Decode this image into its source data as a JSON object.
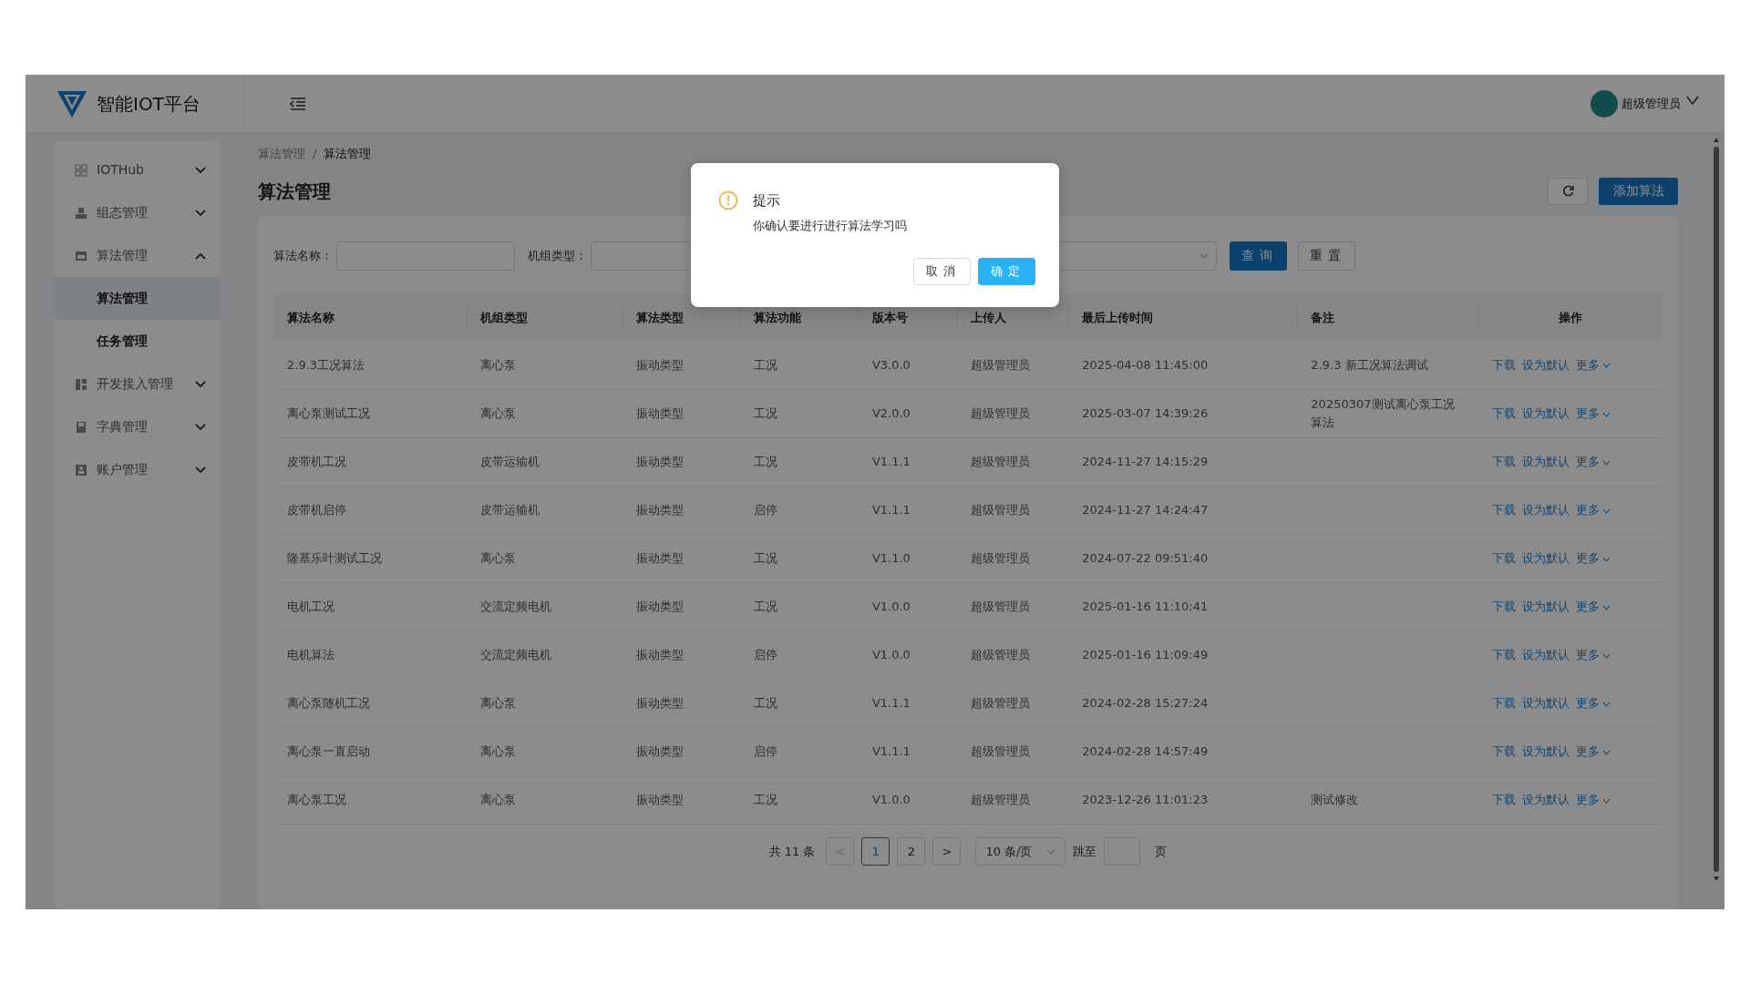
{
  "header": {
    "title": "智能IOT平台",
    "user": "超级管理员"
  },
  "sidebar": {
    "items": [
      {
        "label": "IOTHub",
        "expanded": false
      },
      {
        "label": "组态管理",
        "expanded": false
      },
      {
        "label": "算法管理",
        "expanded": true,
        "children": [
          {
            "label": "算法管理",
            "selected": true
          },
          {
            "label": "任务管理",
            "selected": false
          }
        ]
      },
      {
        "label": "开发接入管理",
        "expanded": false
      },
      {
        "label": "字典管理",
        "expanded": false
      },
      {
        "label": "账户管理",
        "expanded": false
      }
    ]
  },
  "breadcrumb": {
    "items": [
      "算法管理",
      "算法管理"
    ],
    "separator": "/"
  },
  "page_title": "算法管理",
  "add_button": "添加算法",
  "filters": [
    {
      "kind": "text",
      "label": "算法名称："
    },
    {
      "kind": "text",
      "label": "机组类型："
    },
    {
      "kind": "select"
    }
  ],
  "filter_buttons": [
    {
      "kind": "primary",
      "label": "查询"
    },
    {
      "kind": "default",
      "label": "重置"
    }
  ],
  "table": {
    "columns": [
      "算法名称",
      "机组类型",
      "算法类型",
      "算法功能",
      "版本号",
      "上传人",
      "最后上传时间",
      "备注",
      "操作"
    ],
    "rows": [
      {
        "cells": [
          "2.9.3工况算法",
          "离心泵",
          "振动类型",
          "工况",
          "V3.0.0",
          "超级管理员",
          "2025-04-08 11:45:00"
        ],
        "note": "2.9.3 新工况算法调试",
        "actions": [
          "下载",
          "设为默认",
          "更多"
        ]
      },
      {
        "cells": [
          "离心泵测试工况",
          "离心泵",
          "振动类型",
          "工况",
          "V2.0.0",
          "超级管理员",
          "2025-03-07 14:39:26"
        ],
        "note": "20250307测试离心泵工况算法",
        "actions": [
          "下载",
          "设为默认",
          "更多"
        ]
      },
      {
        "cells": [
          "皮带机工况",
          "皮带运输机",
          "振动类型",
          "工况",
          "V1.1.1",
          "超级管理员",
          "2024-11-27 14:15:29"
        ],
        "actions": [
          "下载",
          "设为默认",
          "更多"
        ]
      },
      {
        "cells": [
          "皮带机启停",
          "皮带运输机",
          "振动类型",
          "启停",
          "V1.1.1",
          "超级管理员",
          "2024-11-27 14:24:47"
        ],
        "actions": [
          "下载",
          "设为默认",
          "更多"
        ]
      },
      {
        "cells": [
          "隆基乐叶测试工况",
          "离心泵",
          "振动类型",
          "工况",
          "V1.1.0",
          "超级管理员",
          "2024-07-22 09:51:40"
        ],
        "actions": [
          "下载",
          "设为默认",
          "更多"
        ]
      },
      {
        "cells": [
          "电机工况",
          "交流定频电机",
          "振动类型",
          "工况",
          "V1.0.0",
          "超级管理员",
          "2025-01-16 11:10:41"
        ],
        "actions": [
          "下载",
          "设为默认",
          "更多"
        ]
      },
      {
        "cells": [
          "电机算法",
          "交流定频电机",
          "振动类型",
          "启停",
          "V1.0.0",
          "超级管理员",
          "2025-01-16 11:09:49"
        ],
        "actions": [
          "下载",
          "设为默认",
          "更多"
        ]
      },
      {
        "cells": [
          "离心泵随机工况",
          "离心泵",
          "振动类型",
          "工况",
          "V1.1.1",
          "超级管理员",
          "2024-02-28 15:27:24"
        ],
        "actions": [
          "下载",
          "设为默认",
          "更多"
        ]
      },
      {
        "cells": [
          "离心泵一直启动",
          "离心泵",
          "振动类型",
          "启停",
          "V1.1.1",
          "超级管理员",
          "2024-02-28 14:57:49"
        ],
        "actions": [
          "下载",
          "设为默认",
          "更多"
        ]
      },
      {
        "cells": [
          "离心泵工况",
          "离心泵",
          "振动类型",
          "工况",
          "V1.0.0",
          "超级管理员",
          "2023-12-26 11:01:23"
        ],
        "note": "测试修改",
        "actions": [
          "下载",
          "设为默认",
          "更多"
        ]
      }
    ]
  },
  "pagination": {
    "total": "共 11 条",
    "prev": {
      "label": "<",
      "disabled": true
    },
    "pages": [
      {
        "label": "1",
        "selected": true
      },
      {
        "label": "2",
        "selected": false
      }
    ],
    "next": {
      "label": ">",
      "disabled": false
    },
    "page_size": "10 条/页",
    "jump_label": "跳至",
    "jump_suffix": "页"
  },
  "modal": {
    "title": "提示",
    "message": "你确认要进行进行算法学习吗",
    "buttons": [
      {
        "kind": "default",
        "label": "取消"
      },
      {
        "kind": "primary",
        "label": "确定"
      }
    ]
  }
}
